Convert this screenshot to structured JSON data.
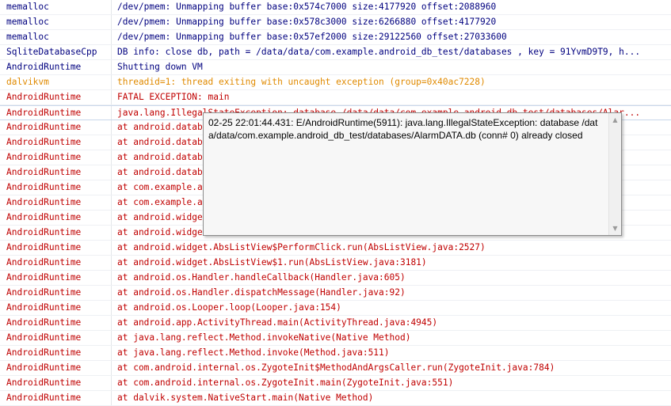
{
  "log_rows": [
    {
      "level": "D",
      "tag": "memalloc",
      "message": "/dev/pmem: Unmapping buffer base:0x574c7000 size:4177920 offset:2088960"
    },
    {
      "level": "D",
      "tag": "memalloc",
      "message": "/dev/pmem: Unmapping buffer base:0x578c3000 size:6266880 offset:4177920"
    },
    {
      "level": "D",
      "tag": "memalloc",
      "message": "/dev/pmem: Unmapping buffer base:0x57ef2000 size:29122560 offset:27033600"
    },
    {
      "level": "D",
      "tag": "SqliteDatabaseCpp",
      "message": "DB info: close db, path = /data/data/com.example.android_db_test/databases , key = 91YvmD9T9, h..."
    },
    {
      "level": "D",
      "tag": "AndroidRuntime",
      "message": "Shutting down VM"
    },
    {
      "level": "W",
      "tag": "dalvikvm",
      "message": "threadid=1: thread exiting with uncaught exception (group=0x40ac7228)"
    },
    {
      "level": "E",
      "tag": "AndroidRuntime",
      "message": "FATAL EXCEPTION: main"
    },
    {
      "level": "E",
      "tag": "AndroidRuntime",
      "message": "java.lang.IllegalStateException: database /data/data/com.example.android_db_test/databases/Alar..."
    },
    {
      "level": "E",
      "tag": "AndroidRuntime",
      "message": "at android.datab"
    },
    {
      "level": "E",
      "tag": "AndroidRuntime",
      "message": "at android.datab"
    },
    {
      "level": "E",
      "tag": "AndroidRuntime",
      "message": "at android.datab"
    },
    {
      "level": "E",
      "tag": "AndroidRuntime",
      "message": "at android.datab"
    },
    {
      "level": "E",
      "tag": "AndroidRuntime",
      "message": "at com.example.a"
    },
    {
      "level": "E",
      "tag": "AndroidRuntime",
      "message": "at com.example.a"
    },
    {
      "level": "E",
      "tag": "AndroidRuntime",
      "message": "at android.widge"
    },
    {
      "level": "E",
      "tag": "AndroidRuntime",
      "message": "at android.widge"
    },
    {
      "level": "E",
      "tag": "AndroidRuntime",
      "message": "at android.widget.AbsListView$PerformClick.run(AbsListView.java:2527)"
    },
    {
      "level": "E",
      "tag": "AndroidRuntime",
      "message": "at android.widget.AbsListView$1.run(AbsListView.java:3181)"
    },
    {
      "level": "E",
      "tag": "AndroidRuntime",
      "message": "at android.os.Handler.handleCallback(Handler.java:605)"
    },
    {
      "level": "E",
      "tag": "AndroidRuntime",
      "message": "at android.os.Handler.dispatchMessage(Handler.java:92)"
    },
    {
      "level": "E",
      "tag": "AndroidRuntime",
      "message": "at android.os.Looper.loop(Looper.java:154)"
    },
    {
      "level": "E",
      "tag": "AndroidRuntime",
      "message": "at android.app.ActivityThread.main(ActivityThread.java:4945)"
    },
    {
      "level": "E",
      "tag": "AndroidRuntime",
      "message": "at java.lang.reflect.Method.invokeNative(Native Method)"
    },
    {
      "level": "E",
      "tag": "AndroidRuntime",
      "message": "at java.lang.reflect.Method.invoke(Method.java:511)"
    },
    {
      "level": "E",
      "tag": "AndroidRuntime",
      "message": "at com.android.internal.os.ZygoteInit$MethodAndArgsCaller.run(ZygoteInit.java:784)"
    },
    {
      "level": "E",
      "tag": "AndroidRuntime",
      "message": "at com.android.internal.os.ZygoteInit.main(ZygoteInit.java:551)"
    },
    {
      "level": "E",
      "tag": "AndroidRuntime",
      "message": "at dalvik.system.NativeStart.main(Native Method)"
    }
  ],
  "selected_row": 7,
  "tooltip": {
    "text": "02-25 22:01:44.431: E/AndroidRuntime(5911): java.lang.IllegalStateException: database /data/data/com.example.android_db_test/databases/AlarmDATA.db (conn# 0) already closed",
    "scroll_up_icon": "triangle-up",
    "scroll_down_icon": "triangle-down"
  },
  "colors": {
    "debug": "#00007f",
    "warning": "#e08a00",
    "error": "#c00000"
  }
}
